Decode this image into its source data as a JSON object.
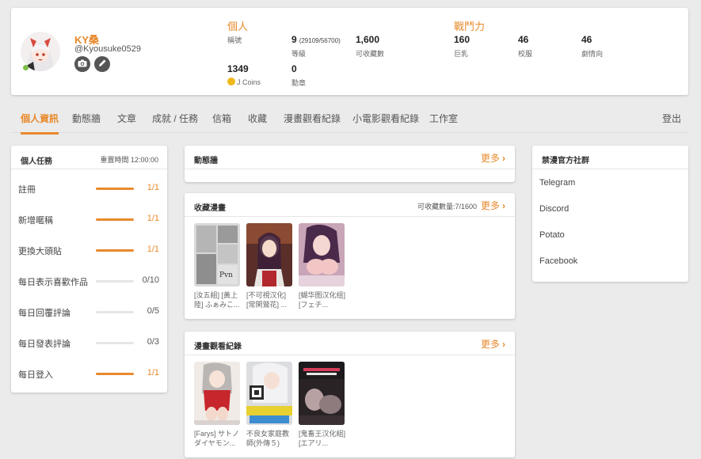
{
  "profile": {
    "username": "KY桑",
    "handle": "@Kyousuke0529",
    "personal_title": "個人",
    "stats": {
      "title_label": "稱號",
      "level_value": "9",
      "level_sub": "(29109/56700)",
      "level_label": "等級",
      "collectible_value": "1,600",
      "collectible_label": "可收藏數",
      "coins_value": "1349",
      "coins_label": "J Coins",
      "medals_value": "0",
      "medals_label": "勳章"
    },
    "combat_title": "戰鬥力",
    "combat": [
      {
        "value": "160",
        "label": "巨乳"
      },
      {
        "value": "46",
        "label": "校服"
      },
      {
        "value": "46",
        "label": "劇情向"
      }
    ]
  },
  "tabs": [
    "個人資訊",
    "動態牆",
    "文章",
    "成就 / 任務",
    "信箱",
    "收藏",
    "漫畫觀看紀錄",
    "小電影觀看紀錄",
    "工作室"
  ],
  "logout": "登出",
  "tasks": {
    "title": "個人任務",
    "reset": "重置時間 12:00:00",
    "items": [
      {
        "name": "註冊",
        "count": "1/1",
        "progress": 1
      },
      {
        "name": "新增暱稱",
        "count": "1/1",
        "progress": 1
      },
      {
        "name": "更換大頭貼",
        "count": "1/1",
        "progress": 1
      },
      {
        "name": "每日表示喜歡作品",
        "count": "0/10",
        "progress": 0
      },
      {
        "name": "每日回覆評論",
        "count": "0/5",
        "progress": 0
      },
      {
        "name": "每日發表評論",
        "count": "0/3",
        "progress": 0
      },
      {
        "name": "每日登入",
        "count": "1/1",
        "progress": 1
      }
    ]
  },
  "wall": {
    "title": "動態牆",
    "more": "更多"
  },
  "favorites": {
    "title": "收藏漫畫",
    "capacity": "可收藏數量:7/1600",
    "more": "更多",
    "items": [
      {
        "caption": "[汝五組] [黃上陸] ふぁみこ..."
      },
      {
        "caption": "[不可視汉化] [常閑鷲花] ..."
      },
      {
        "caption": "[蝴华图汉化组] [フェチ..."
      }
    ]
  },
  "history": {
    "title": "漫畫觀看紀錄",
    "more": "更多",
    "items": [
      {
        "caption": "[Farys] サトノダイヤモン..."
      },
      {
        "caption": "不良女家庭教師(外傳５)"
      },
      {
        "caption": "[鬼畜王汉化組] [エアリ..."
      }
    ]
  },
  "community": {
    "title": "禁漫官方社群",
    "items": [
      "Telegram",
      "Discord",
      "Potato",
      "Facebook"
    ]
  },
  "colors": {
    "accent": "#e8892c",
    "online": "#7cc04a",
    "coin": "#f0b81c"
  }
}
